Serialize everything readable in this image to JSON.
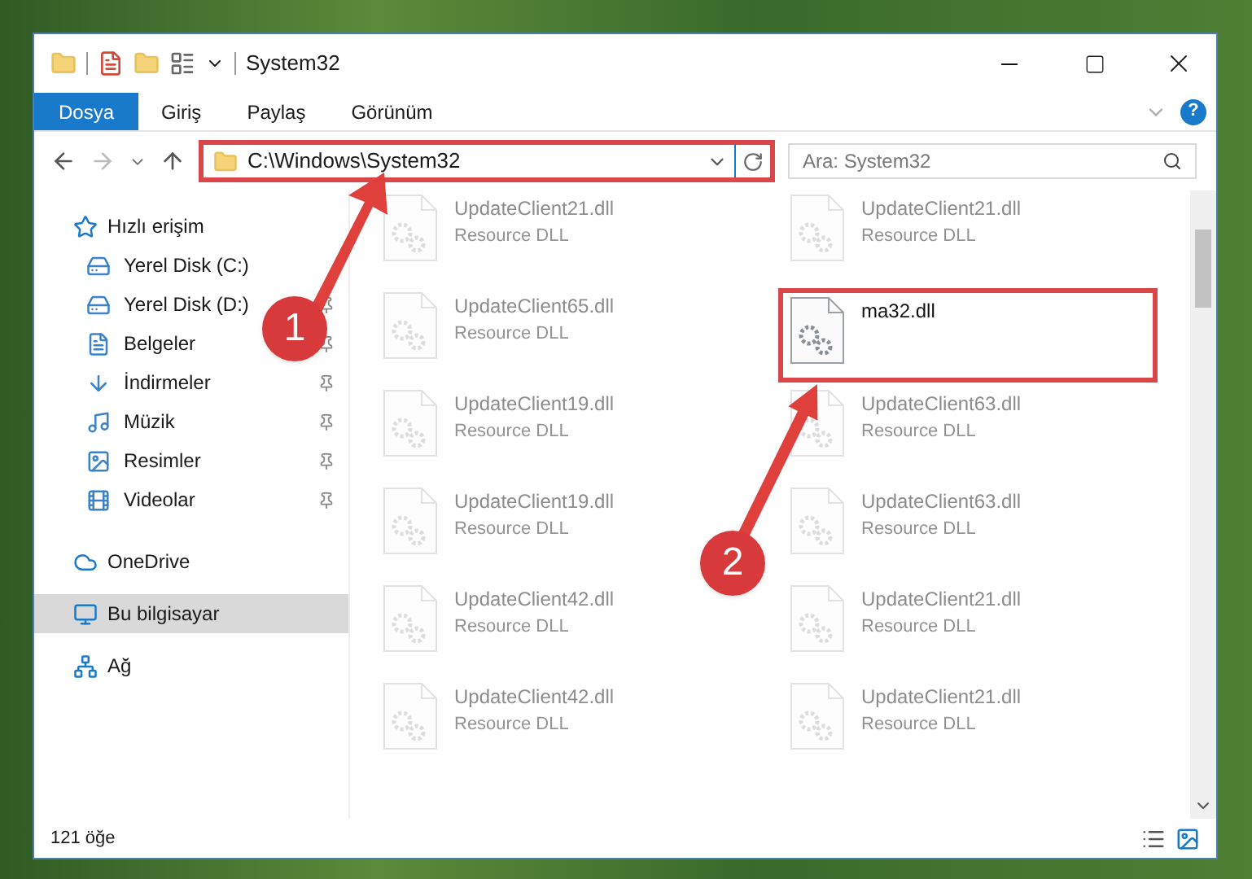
{
  "window": {
    "title": "System32"
  },
  "ribbon_tabs": [
    {
      "label": "Dosya",
      "selected": true
    },
    {
      "label": "Giriş",
      "selected": false
    },
    {
      "label": "Paylaş",
      "selected": false
    },
    {
      "label": "Görünüm",
      "selected": false
    }
  ],
  "address_bar": {
    "value": "C:\\Windows\\System32",
    "highlighted": true
  },
  "help": {
    "label": "?"
  },
  "search": {
    "placeholder": "Ara: System32"
  },
  "sidebar": {
    "items": [
      {
        "label": "Hızlı erişim",
        "selected": false,
        "children": [
          {
            "label": "Yerel Disk (C:)",
            "pinned": false,
            "selected": false
          },
          {
            "label": "Yerel Disk (D:)",
            "pinned": true,
            "selected": false
          },
          {
            "label": "Belgeler",
            "pinned": true,
            "selected": false
          },
          {
            "label": "İndirmeler",
            "pinned": true,
            "selected": false
          },
          {
            "label": "Müzik",
            "pinned": true,
            "selected": false
          },
          {
            "label": "Resimler",
            "pinned": true,
            "selected": false
          },
          {
            "label": "Videolar",
            "pinned": true,
            "selected": false
          }
        ]
      },
      {
        "label": "OneDrive",
        "selected": false
      },
      {
        "label": "Bu bilgisayar",
        "selected": true
      },
      {
        "label": "Ağ",
        "selected": false
      }
    ]
  },
  "files": [
    {
      "name": "UpdateClient21.dll",
      "type": "Resource DLL",
      "dimmed": true,
      "highlighted": false
    },
    {
      "name": "UpdateClient21.dll",
      "type": "Resource DLL",
      "dimmed": true,
      "highlighted": false
    },
    {
      "name": "UpdateClient65.dll",
      "type": "Resource DLL",
      "dimmed": true,
      "highlighted": false
    },
    {
      "name": "ma32.dll",
      "dimmed": false,
      "highlighted": true
    },
    {
      "name": "UpdateClient19.dll",
      "type": "Resource DLL",
      "dimmed": true,
      "highlighted": false
    },
    {
      "name": "UpdateClient63.dll",
      "type": "Resource DLL",
      "dimmed": true,
      "highlighted": false
    },
    {
      "name": "UpdateClient19.dll",
      "type": "Resource DLL",
      "dimmed": true,
      "highlighted": false
    },
    {
      "name": "UpdateClient63.dll",
      "type": "Resource DLL",
      "dimmed": true,
      "highlighted": false
    },
    {
      "name": "UpdateClient42.dll",
      "type": "Resource DLL",
      "dimmed": true,
      "highlighted": false
    },
    {
      "name": "UpdateClient21.dll",
      "type": "Resource DLL",
      "dimmed": true,
      "highlighted": false
    },
    {
      "name": "UpdateClient42.dll",
      "type": "Resource DLL",
      "dimmed": true,
      "highlighted": false
    },
    {
      "name": "UpdateClient21.dll",
      "type": "Resource DLL",
      "dimmed": true,
      "highlighted": false
    }
  ],
  "status_bar": {
    "count": "121 öğe"
  },
  "callouts": [
    {
      "number": "1"
    },
    {
      "number": "2"
    }
  ]
}
